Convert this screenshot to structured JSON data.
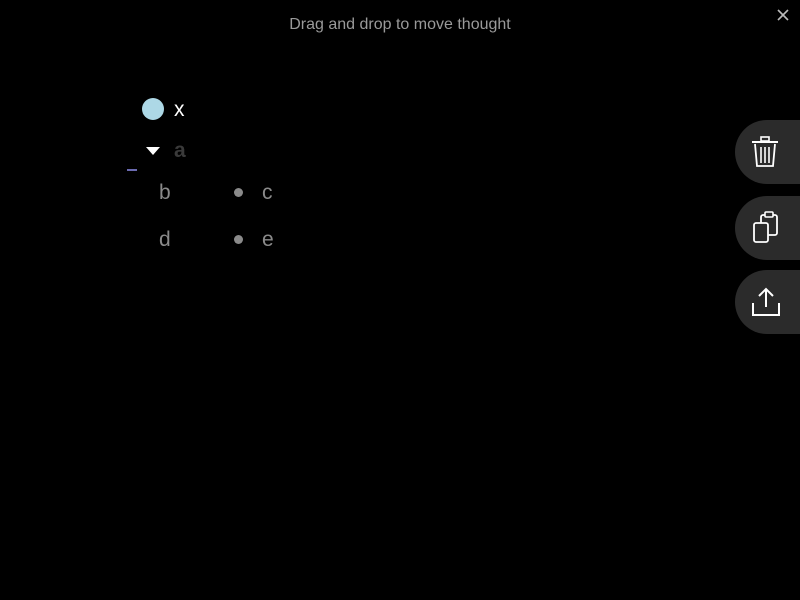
{
  "hint": {
    "text": "Drag and drop to move thought"
  },
  "thoughts": {
    "root": {
      "label": "x"
    },
    "dragging": {
      "label": "a"
    },
    "children": [
      {
        "label": "b"
      },
      {
        "label": "c"
      },
      {
        "label": "d"
      },
      {
        "label": "e"
      }
    ]
  },
  "toolbar": {
    "delete_icon": "trash-icon",
    "copy_icon": "clipboard-copy-icon",
    "export_icon": "share-export-icon"
  },
  "colors": {
    "background": "#000000",
    "bullet": "#add8e6",
    "hint_text": "#9a9a9a",
    "child_text": "#8a8a8a",
    "dragged_text": "#3a3a3a",
    "drop_indicator": "#6a6ab0",
    "toolbar_bg": "#2b2b2b"
  }
}
